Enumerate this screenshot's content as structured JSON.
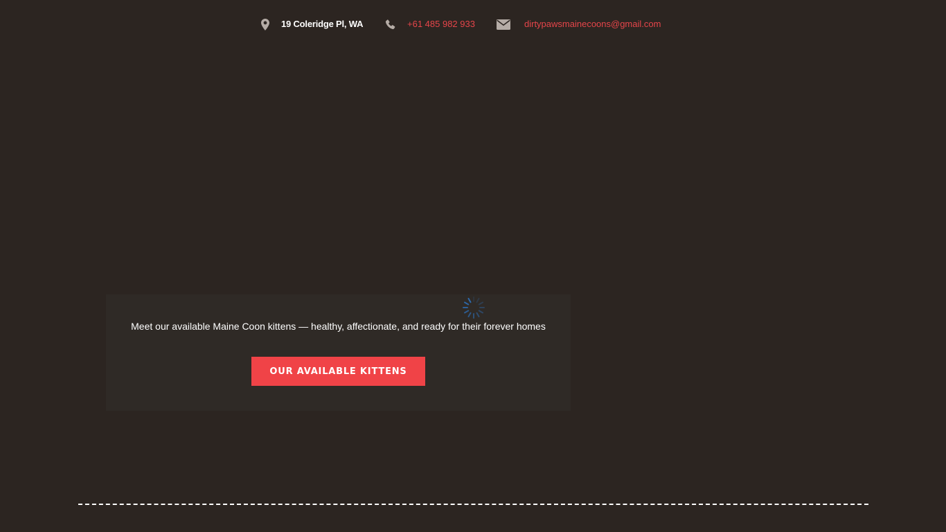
{
  "topbar": {
    "address": {
      "icon": "map-pin-icon",
      "text": "19 Coleridge Pl, WA"
    },
    "phone": {
      "icon": "phone-icon",
      "text": "+61 485 982 933"
    },
    "email": {
      "icon": "envelope-icon",
      "text": "dirtypawsmainecoons@gmail.com"
    }
  },
  "hero": {
    "text": "Meet our available Maine Coon kittens — healthy, affectionate, and ready for their forever homes",
    "button_label": "OUR AVAILABLE KITTENS",
    "loading_icon": "loading-spinner-icon"
  },
  "colors": {
    "background": "#2c2521",
    "panel": "#2f2a26",
    "accent": "#f04347",
    "link": "#e6454a",
    "icon": "#b5aca6",
    "spinner": "#2d6fb8"
  }
}
